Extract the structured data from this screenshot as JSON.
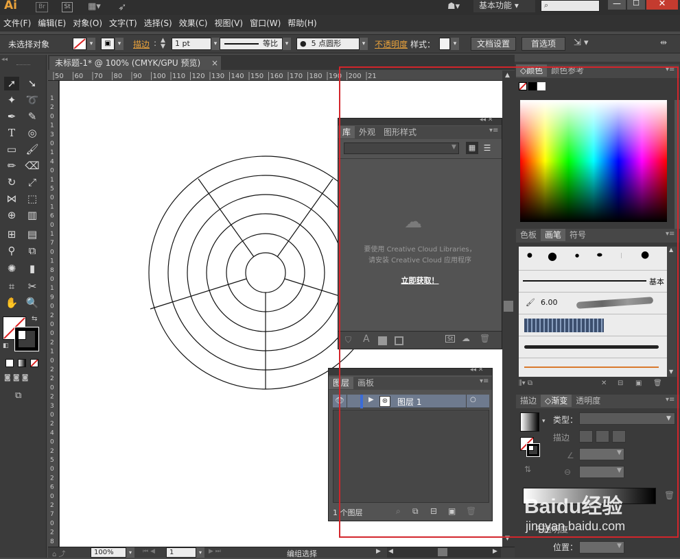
{
  "app": {
    "logo": "Ai",
    "logo_icon": "illustrator-logo",
    "bridge": "Br",
    "stock": "St",
    "workspace": "基本功能",
    "search_placeholder": ""
  },
  "menu": [
    "文件(F)",
    "编辑(E)",
    "对象(O)",
    "文字(T)",
    "选择(S)",
    "效果(C)",
    "视图(V)",
    "窗口(W)",
    "帮助(H)"
  ],
  "control": {
    "selection": "未选择对象",
    "stroke_label": "描边",
    "stroke_weight": "1 pt",
    "profile": "等比",
    "brush": "5 点圆形",
    "opacity_label": "不透明度",
    "style_label": "样式：",
    "doc_setup": "文档设置",
    "prefs": "首选项"
  },
  "document": {
    "tab_title": "未标题-1* @ 100% (CMYK/GPU 预览)",
    "close": "×"
  },
  "ruler": {
    "h_ticks": [
      "50",
      "60",
      "70",
      "80",
      "90",
      "100",
      "110",
      "120",
      "130",
      "140",
      "150",
      "160",
      "170",
      "180",
      "190",
      "200",
      "21"
    ],
    "v_ticks": [
      "1",
      "2",
      "0",
      "1",
      "3",
      "0",
      "1",
      "4",
      "0",
      "1",
      "5",
      "0",
      "1",
      "6",
      "0",
      "1",
      "7",
      "0",
      "1",
      "8",
      "0",
      "1",
      "9",
      "0",
      "2",
      "0",
      "0",
      "2",
      "1",
      "0",
      "2",
      "2",
      "0",
      "2",
      "3",
      "0",
      "2",
      "4",
      "0",
      "2",
      "5",
      "0",
      "2",
      "6",
      "0",
      "2",
      "7",
      "0",
      "2",
      "8",
      "0"
    ]
  },
  "library_panel": {
    "tabs": [
      "库",
      "外观",
      "图形样式"
    ],
    "message_line1": "要使用 Creative Cloud Libraries，",
    "message_line2": "请安装 Creative Cloud 应用程序",
    "get_link": "立即获取！",
    "footer_text_a": "A",
    "footer_st": "St"
  },
  "layers_panel": {
    "tabs": [
      "图层",
      "画板"
    ],
    "layer_name": "图层 1",
    "count": "1 个图层"
  },
  "color_panel": {
    "tabs": [
      "颜色",
      "颜色参考"
    ]
  },
  "brush_panel": {
    "tabs": [
      "色板",
      "画笔",
      "符号"
    ],
    "basic_label": "基本",
    "brush_size": "6.00"
  },
  "gradient_panel": {
    "tabs": [
      "描边",
      "渐变",
      "透明度"
    ],
    "type_label": "类型：",
    "stroke_label": "描边",
    "opacity_label": "不透明度",
    "position_label": "位置："
  },
  "status": {
    "zoom": "100%",
    "artboard": "1",
    "mode": "编组选择"
  },
  "watermark": {
    "brand": "Baidu经验",
    "url": "jingyan.baidu.com"
  },
  "colors": {
    "highlight": "#d3252b",
    "canvas": "#ffffff",
    "ui_dark": "#3b3b3b"
  }
}
